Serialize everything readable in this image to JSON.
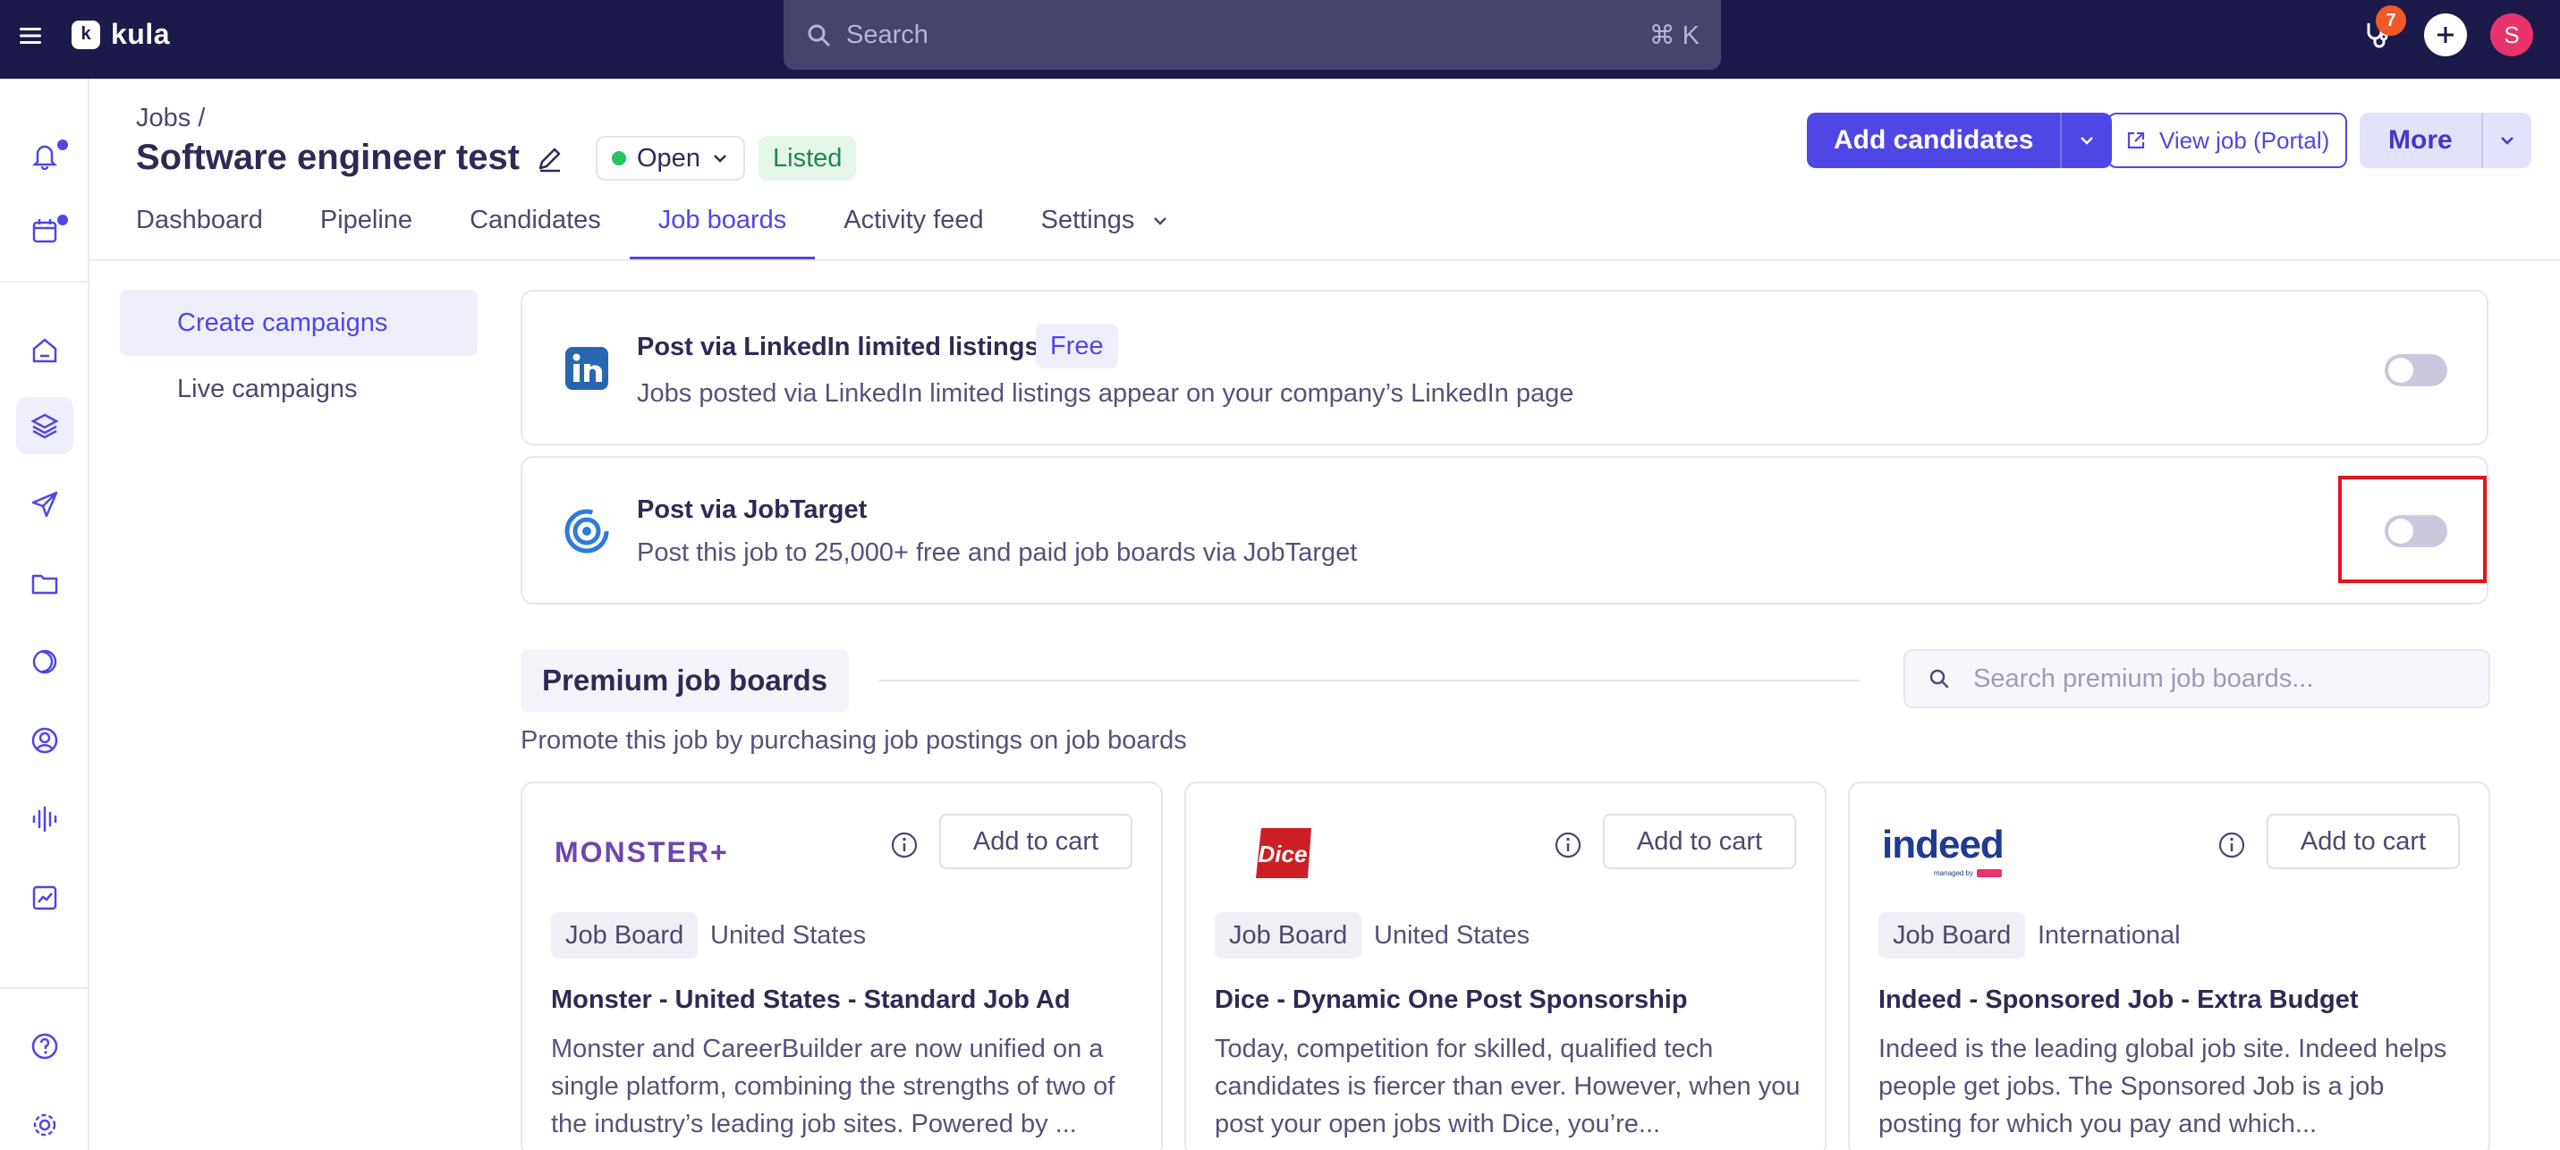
{
  "app": {
    "name": "kula"
  },
  "search": {
    "placeholder": "Search",
    "shortcut": "⌘ K"
  },
  "topbar": {
    "notification_count": "7",
    "avatar_initial": "S"
  },
  "sidebar": {
    "icons": [
      "bell-icon",
      "calendar-icon",
      "home-icon",
      "layers-icon",
      "send-icon",
      "folder-icon",
      "half-circle-icon",
      "user-circle-icon",
      "audio-wave-icon",
      "chart-icon",
      "help-icon",
      "settings-icon"
    ]
  },
  "header": {
    "breadcrumb": "Jobs /",
    "title": "Software engineer test",
    "status": "Open",
    "listed": "Listed",
    "add_candidates": "Add candidates",
    "view_job": "View job (Portal)",
    "more": "More"
  },
  "tabs": [
    "Dashboard",
    "Pipeline",
    "Candidates",
    "Job boards",
    "Activity feed",
    "Settings"
  ],
  "active_tab": "Job boards",
  "subnav": [
    "Create campaigns",
    "Live campaigns"
  ],
  "integrations": [
    {
      "title": "Post via LinkedIn limited listings",
      "badge": "Free",
      "description": "Jobs posted via LinkedIn limited listings appear on your company’s LinkedIn page",
      "enabled": false
    },
    {
      "title": "Post via JobTarget",
      "description": "Post this job to 25,000+ free and paid job boards via JobTarget",
      "enabled": false
    }
  ],
  "premium": {
    "heading": "Premium job boards",
    "search_placeholder": "Search premium job boards...",
    "description": "Promote this job by purchasing job postings on job boards",
    "cards": [
      {
        "logo": "MONSTER+",
        "cart": "Add to cart",
        "tag": "Job Board",
        "region": "United States",
        "title": "Monster - United States - Standard Job Ad",
        "description": "Monster and CareerBuilder are now unified on a single platform, combining the strengths of two of the industry’s leading job sites. Powered by ..."
      },
      {
        "logo": "Dice",
        "cart": "Add to cart",
        "tag": "Job Board",
        "region": "United States",
        "title": "Dice - Dynamic One Post Sponsorship",
        "description": "Today, competition for skilled, qualified tech candidates is fiercer than ever. However, when you post your open jobs with Dice, you’re..."
      },
      {
        "logo": "indeed",
        "logo_sub": "managed by",
        "cart": "Add to cart",
        "tag": "Job Board",
        "region": "International",
        "title": "Indeed - Sponsored Job - Extra Budget",
        "description": "Indeed is the leading global job site. Indeed helps people get jobs. The Sponsored Job is a job posting for which you pay and which..."
      }
    ]
  },
  "colors": {
    "accent": "#4f46e5",
    "topbar": "#1c1a4a",
    "highlight": "#e5141b"
  }
}
